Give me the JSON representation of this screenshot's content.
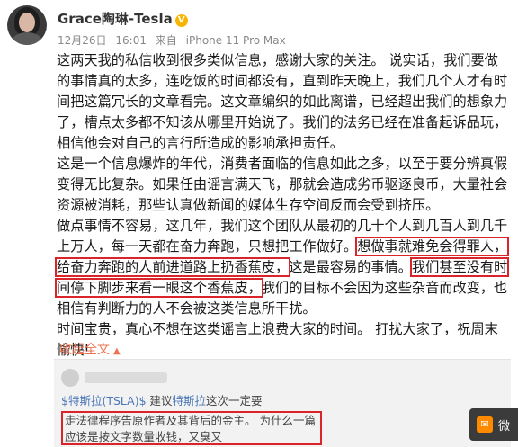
{
  "header": {
    "username": "Grace陶琳-Tesla",
    "verified_badge": "V",
    "date": "12月26日",
    "time": "16:01",
    "source_prefix": "来自",
    "device": "iPhone 11 Pro Max"
  },
  "post": {
    "p1": "这两天我的私信收到很多类似信息，感谢大家的关注。 说实话，我们要做的事情真的太多，连吃饭的时间都没有，直到昨天晚上，我们几个人才有时间把这篇冗长的文章看完。这文章编织的如此离谱，已经超出我们的想象力了，槽点太多都不知该从哪里开始说了。我们的法务已经在准备起诉品玩，相信他会对自己的言行所造成的影响承担责任。",
    "p2": "这是一个信息爆炸的年代，消费者面临的信息如此之多，以至于要分辨真假变得无比复杂。如果任由谣言满天飞，那就会造成劣币驱逐良币，大量社会资源被消耗，那些认真做新闻的媒体生存空间反而会受到挤压。",
    "p3_a": "做点事情不容易，这几年，我们这个团队从最初的几十个人到几百人到几千上万人，每一天都在奋力奔跑，只想把工作做好。",
    "p3_hl1": "想做事就难免会得罪人，给奋力奔跑的人前进道路上扔香蕉皮，",
    "p3_b": "这是最容易的事情。",
    "p3_hl2": "我们甚至没有时间停下脚步来看一眼这个香蕉皮，",
    "p3_c": "我们的目标不会因为这些杂音而改变，也相信有判断力的人不会被这类信息所干扰。",
    "p4": "时间宝贵，真心不想在这类谣言上浪费大家的时间。 打扰大家了，祝周末愉快!"
  },
  "collapse_label": "收起全文",
  "quote": {
    "mention": "$特斯拉(TSLA)$",
    "text_a": " 建议",
    "mention2": "特斯拉",
    "text_b": "这次一定要",
    "highlighted": "走法律程序告原作者及其背后的金主。 为什么一篇应该是按文字数量收钱，又臭又"
  },
  "toast": {
    "label": "微"
  }
}
